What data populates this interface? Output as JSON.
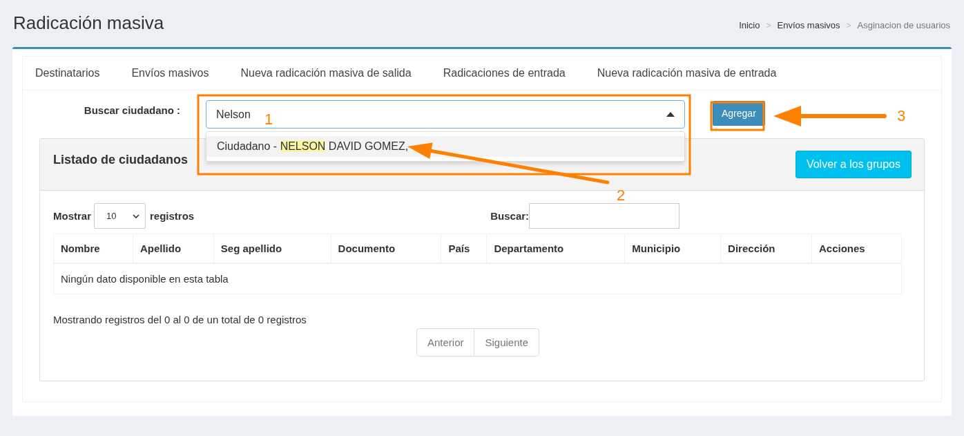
{
  "header": {
    "title": "Radicación masiva",
    "separator": ">",
    "breadcrumb": [
      {
        "label": "Inicio",
        "current": false
      },
      {
        "label": "Envíos masivos",
        "current": false
      },
      {
        "label": "Asginacion de usuarios",
        "current": true
      }
    ]
  },
  "tabs": [
    {
      "label": "Destinatarios"
    },
    {
      "label": "Envíos masivos"
    },
    {
      "label": "Nueva radicación masiva de salida"
    },
    {
      "label": "Radicaciones de entrada"
    },
    {
      "label": "Nueva radicación masiva de entrada"
    }
  ],
  "search": {
    "label": "Buscar ciudadano :",
    "value": "Nelson",
    "expanded": true,
    "results": [
      {
        "prefix": "Ciudadano - ",
        "match": "NELSON",
        "rest": " DAVID GOMEZ,"
      }
    ],
    "button": "Agregar"
  },
  "panel": {
    "title": "Listado de ciudadanos",
    "back_button": "Volver a los grupos",
    "show_label": "Mostrar",
    "page_size": "10",
    "show_suffix": "registros",
    "search_label": "Buscar:",
    "columns": [
      "Nombre",
      "Apellido",
      "Seg apellido",
      "Documento",
      "País",
      "Departamento",
      "Municipio",
      "Dirección",
      "Acciones"
    ],
    "empty_message": "Ningún dato disponible en esta tabla",
    "info": "Mostrando registros del 0 al 0 de un total de 0 registros",
    "pagination": [
      {
        "label": "Anterior",
        "disabled": true
      },
      {
        "label": "Siguiente",
        "disabled": true
      }
    ]
  },
  "annotations": [
    {
      "label": "1"
    },
    {
      "label": "2"
    },
    {
      "label": "3"
    }
  ]
}
